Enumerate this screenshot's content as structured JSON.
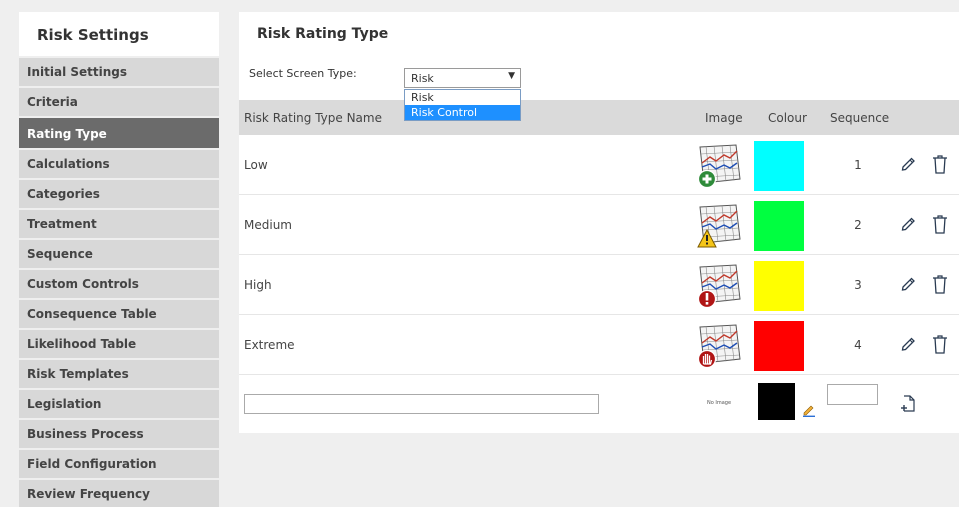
{
  "sidebar": {
    "title": "Risk Settings",
    "items": [
      {
        "label": "Initial Settings",
        "active": false
      },
      {
        "label": "Criteria",
        "active": false
      },
      {
        "label": "Rating Type",
        "active": true
      },
      {
        "label": "Calculations",
        "active": false
      },
      {
        "label": "Categories",
        "active": false
      },
      {
        "label": "Treatment",
        "active": false
      },
      {
        "label": "Sequence",
        "active": false
      },
      {
        "label": "Custom Controls",
        "active": false
      },
      {
        "label": "Consequence Table",
        "active": false
      },
      {
        "label": "Likelihood Table",
        "active": false
      },
      {
        "label": "Risk Templates",
        "active": false
      },
      {
        "label": "Legislation",
        "active": false
      },
      {
        "label": "Business Process",
        "active": false
      },
      {
        "label": "Field Configuration",
        "active": false
      },
      {
        "label": "Review Frequency",
        "active": false
      }
    ]
  },
  "main": {
    "title": "Risk Rating Type",
    "screen_type_label": "Select Screen Type:",
    "screen_type_value": "Risk",
    "screen_type_options": [
      {
        "label": "Risk",
        "highlighted": false
      },
      {
        "label": "Risk Control",
        "highlighted": true
      }
    ]
  },
  "table": {
    "headers": {
      "name": "Risk Rating Type Name",
      "image": "Image",
      "colour": "Colour",
      "sequence": "Sequence"
    },
    "rows": [
      {
        "name": "Low",
        "colour": "#00ffff",
        "sequence": "1",
        "badge": "plus"
      },
      {
        "name": "Medium",
        "colour": "#00ff40",
        "sequence": "2",
        "badge": "warning"
      },
      {
        "name": "High",
        "colour": "#ffff00",
        "sequence": "3",
        "badge": "exclamation"
      },
      {
        "name": "Extreme",
        "colour": "#ff0000",
        "sequence": "4",
        "badge": "stop-hand"
      }
    ],
    "new_row": {
      "no_image_text": "No Image",
      "colour": "#000000",
      "name_value": "",
      "sequence_value": ""
    }
  }
}
